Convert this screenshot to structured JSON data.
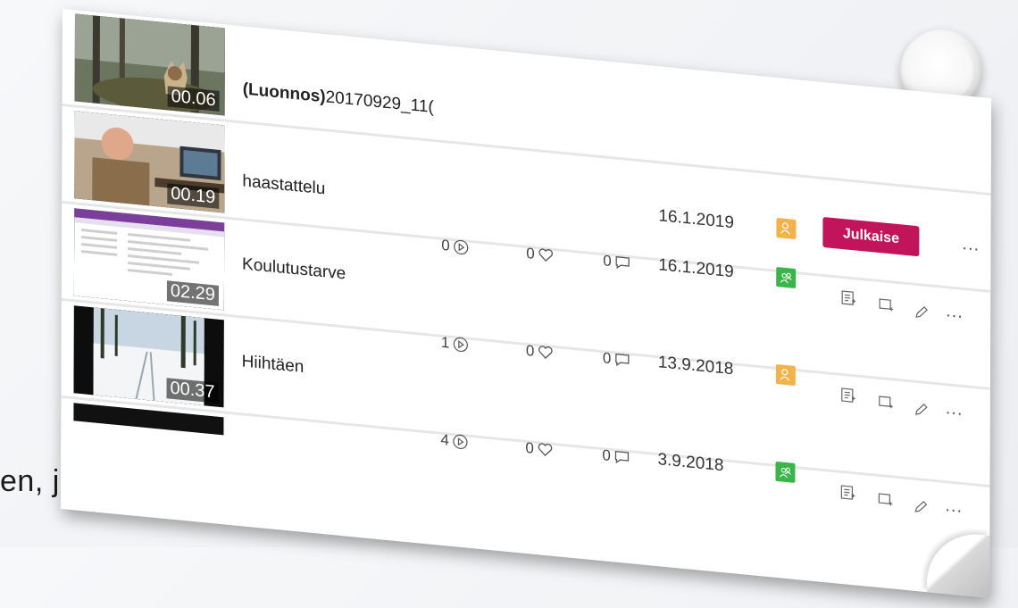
{
  "caption": "en, jako",
  "colors": {
    "publish": "#c2145a",
    "private_badge": "#f4b24a",
    "public_badge": "#3ab54a"
  },
  "rows": [
    {
      "title_prefix": "(Luonnos)",
      "title": "20170929_11(",
      "duration": "00.06",
      "thumbnail": "dog-in-forest"
    },
    {
      "title": "haastattelu",
      "duration": "00.19",
      "thumbnail": "man-at-computer",
      "date": "16.1.2019",
      "permission": "private",
      "publish_label": "Julkaise",
      "more": "..."
    },
    {
      "title": "Koulutustarve",
      "duration": "02.29",
      "thumbnail": "spreadsheet",
      "views": "0",
      "likes": "0",
      "comments": "0",
      "date": "16.1.2019",
      "permission": "public",
      "more": "..."
    },
    {
      "title": "Hiihtäen",
      "duration": "00.37",
      "thumbnail": "ski-track",
      "views": "1",
      "likes": "0",
      "comments": "0",
      "date": "13.9.2018",
      "permission": "private",
      "more": "..."
    },
    {
      "views": "4",
      "likes": "0",
      "comments": "0",
      "date": "3.9.2018",
      "permission": "public",
      "more": "..."
    }
  ]
}
